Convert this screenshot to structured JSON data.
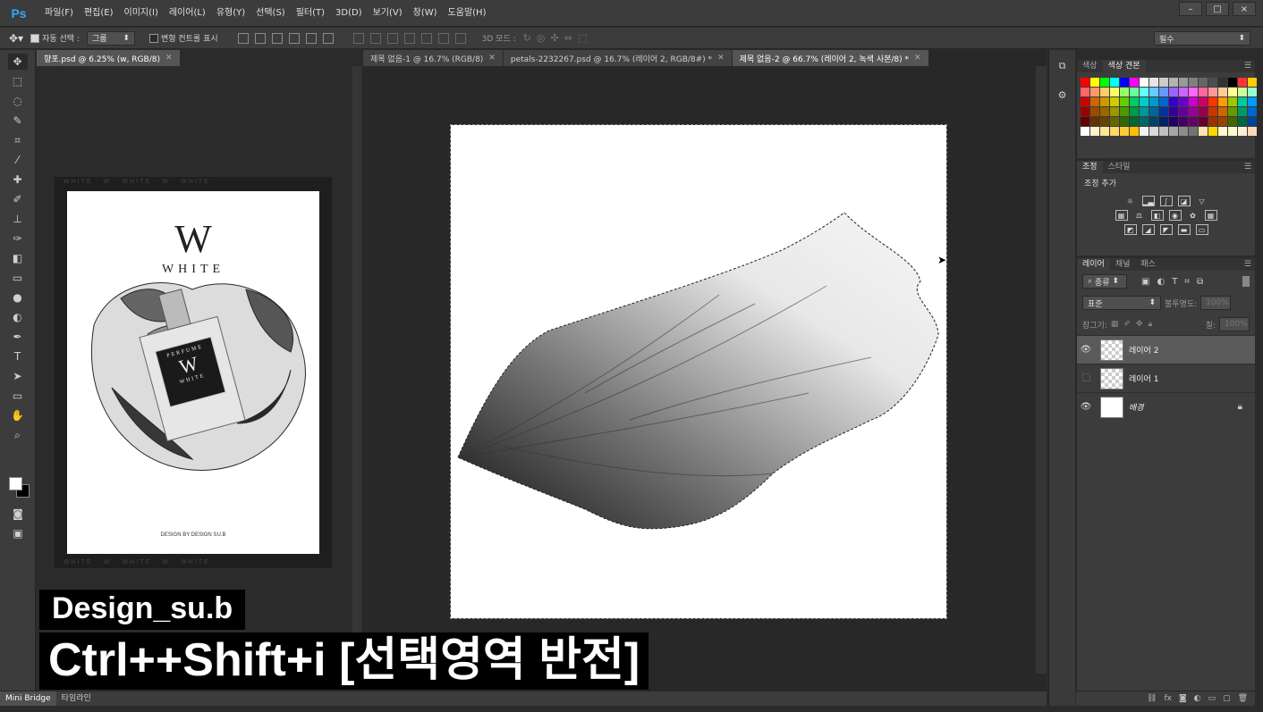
{
  "app": {
    "logo": "Ps",
    "menu": [
      "파일(F)",
      "편집(E)",
      "이미지(I)",
      "레이어(L)",
      "유형(Y)",
      "선택(S)",
      "필터(T)",
      "3D(D)",
      "보기(V)",
      "창(W)",
      "도움말(H)"
    ],
    "window_controls": [
      "–",
      "□",
      "×"
    ]
  },
  "options": {
    "auto_select_label": "자동 선택 :",
    "auto_select_value": "그룹",
    "transform_controls_label": "변형 컨트롤 표시",
    "mode_3d_label": "3D 모드 :",
    "workspace_value": "필수"
  },
  "tools": [
    "move-tool",
    "marquee-tool",
    "lasso-tool",
    "quick-select-tool",
    "crop-tool",
    "eyedropper-tool",
    "healing-tool",
    "brush-tool",
    "stamp-tool",
    "history-brush-tool",
    "eraser-tool",
    "gradient-tool",
    "blur-tool",
    "dodge-tool",
    "pen-tool",
    "type-tool",
    "path-select-tool",
    "shape-tool",
    "hand-tool",
    "zoom-tool"
  ],
  "doc_left": {
    "tab_label": "향포.psd @ 6.25% (w, RGB/8)",
    "poster": {
      "logo_letter": "W",
      "title": "WHITE",
      "border_text": "WHITE · W · WHITE · W · WHITE",
      "credit": "DESIGN BY DESIGN SU.B",
      "bottle_label_top": "PERFUME",
      "bottle_label_letter": "W",
      "bottle_label_sub": "WHITE"
    }
  },
  "doc_main": {
    "tabs": [
      {
        "label": "제목 없음-1 @ 16.7% (RGB/8)",
        "active": false
      },
      {
        "label": "petals-2232267.psd @ 16.7% (레이어 2, RGB/8#) *",
        "active": false
      },
      {
        "label": "제목 없음-2 @ 66.7% (레이어 2, 녹색 사본/8) *",
        "active": true
      }
    ]
  },
  "bottom_bar": {
    "tabs": [
      "Mini Bridge",
      "타임라인"
    ]
  },
  "swatches_panel": {
    "tabs": [
      "색상",
      "색상 견본"
    ],
    "colors": [
      "#ff0000",
      "#ffff00",
      "#00ff00",
      "#00ffff",
      "#0000ff",
      "#ff00ff",
      "#ffffff",
      "#e6e6e6",
      "#cccccc",
      "#b3b3b3",
      "#999999",
      "#808080",
      "#666666",
      "#4d4d4d",
      "#333333",
      "#000000",
      "#ff3333",
      "#ffcc00",
      "#ff6666",
      "#ff9966",
      "#ffcc66",
      "#ffff66",
      "#99ff66",
      "#66ff99",
      "#66ffff",
      "#66ccff",
      "#6699ff",
      "#9966ff",
      "#cc66ff",
      "#ff66ff",
      "#ff6699",
      "#ff9999",
      "#ffcc99",
      "#ffff99",
      "#ccff99",
      "#99ffcc",
      "#cc0000",
      "#cc6600",
      "#cc9900",
      "#cccc00",
      "#66cc00",
      "#00cc66",
      "#00cccc",
      "#0099cc",
      "#0066cc",
      "#3300cc",
      "#6600cc",
      "#cc00cc",
      "#cc0066",
      "#ff3300",
      "#ff9900",
      "#99cc00",
      "#00cc99",
      "#0099ff",
      "#990000",
      "#994c00",
      "#996600",
      "#999900",
      "#4c9900",
      "#00994c",
      "#009999",
      "#006699",
      "#003399",
      "#330099",
      "#660099",
      "#990099",
      "#99004c",
      "#cc3300",
      "#cc6600",
      "#669900",
      "#009966",
      "#0066cc",
      "#660000",
      "#663300",
      "#664400",
      "#666600",
      "#336600",
      "#006633",
      "#006666",
      "#004466",
      "#002266",
      "#220066",
      "#440066",
      "#660066",
      "#660033",
      "#993300",
      "#994400",
      "#446600",
      "#006644",
      "#004499",
      "#ffffff",
      "#fff2cc",
      "#ffe699",
      "#ffd966",
      "#ffcc33",
      "#ffbf00",
      "#f2f2f2",
      "#d9d9d9",
      "#bfbfbf",
      "#a6a6a6",
      "#8c8c8c",
      "#737373",
      "#ffe5b4",
      "#ffd700",
      "#fffacd",
      "#fafad2",
      "#ffefd5",
      "#ffdab9"
    ]
  },
  "adjust_panel": {
    "tabs": [
      "조정",
      "스타일"
    ],
    "title": "조정 추가"
  },
  "layers_panel": {
    "tabs": [
      "레이어",
      "채널",
      "패스"
    ],
    "filter_label": "종류",
    "blend_mode": "표준",
    "opacity_label": "불투명도:",
    "opacity_value": "100%",
    "lock_label": "잠그기:",
    "fill_label": "칠:",
    "fill_value": "100%",
    "layers": [
      {
        "name": "레이어 2",
        "visible": true,
        "active": true,
        "thumb": "checker"
      },
      {
        "name": "레이어 1",
        "visible": false,
        "active": false,
        "thumb": "checker"
      },
      {
        "name": "배경",
        "visible": true,
        "active": false,
        "thumb": "white",
        "locked": true
      }
    ]
  },
  "caption": {
    "line1": "Design_su.b",
    "line2": "Ctrl++Shift+i [선택영역 반전]"
  }
}
